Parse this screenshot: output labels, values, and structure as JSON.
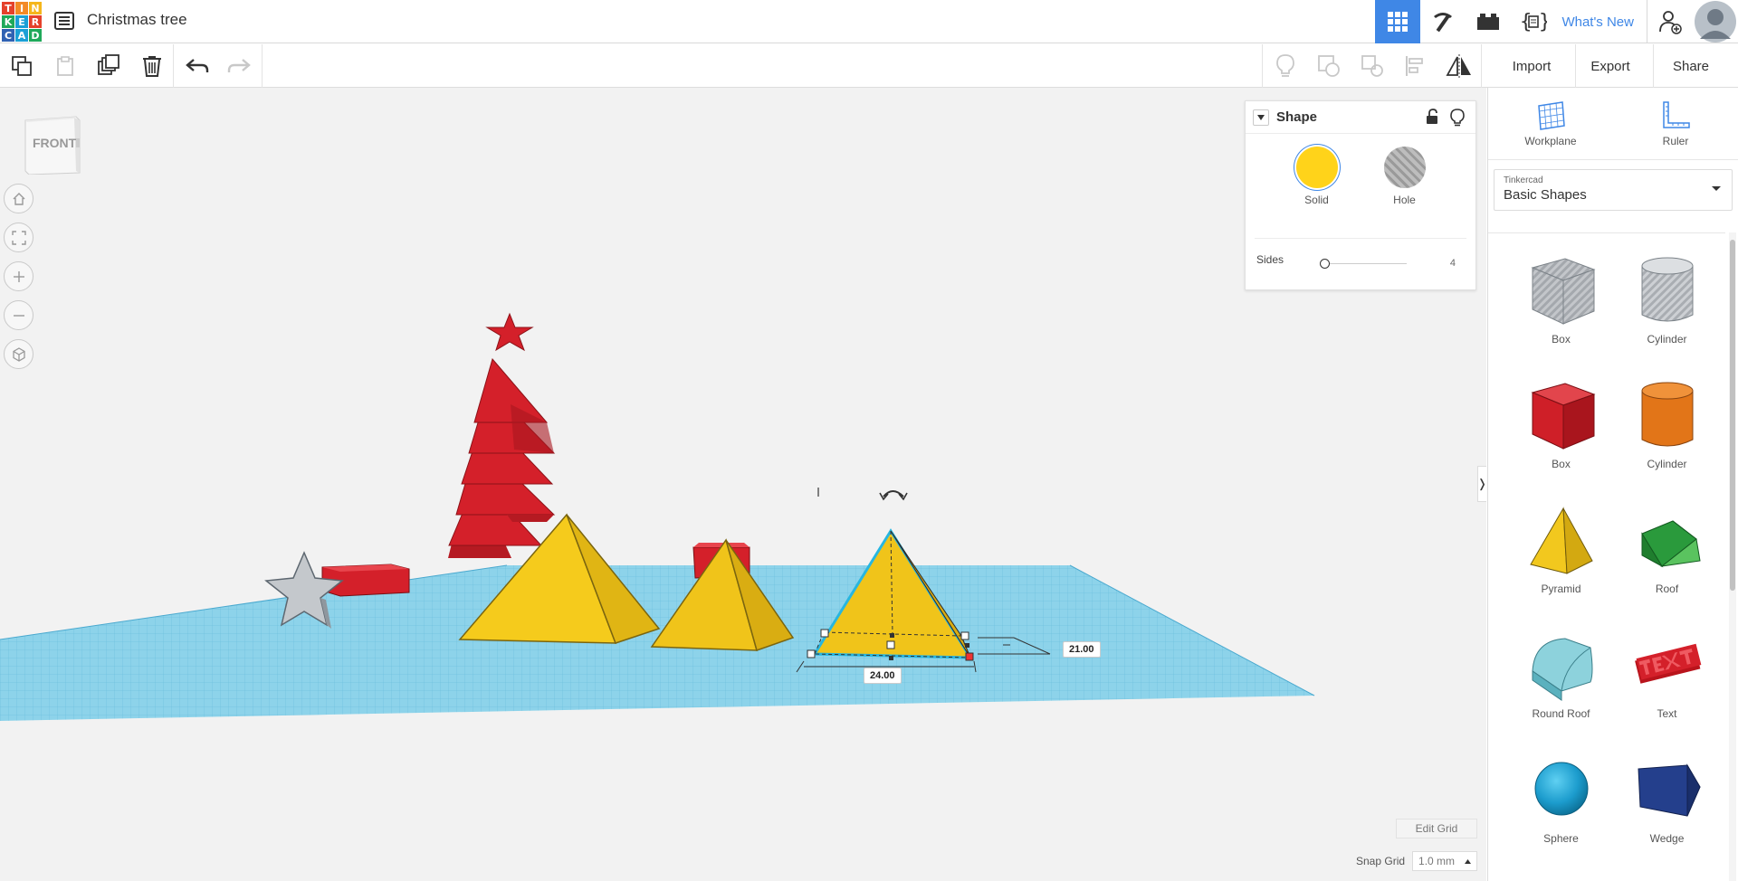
{
  "logo": {
    "letters": [
      "T",
      "I",
      "N",
      "K",
      "E",
      "R",
      "C",
      "A",
      "D"
    ]
  },
  "document": {
    "title": "Christmas tree"
  },
  "topbar": {
    "whats_new": "What's New"
  },
  "toolbar": {
    "import": "Import",
    "export": "Export",
    "share": "Share"
  },
  "viewcube": {
    "face": "FRONT"
  },
  "inspector": {
    "title": "Shape",
    "solid_label": "Solid",
    "hole_label": "Hole",
    "sides_label": "Sides",
    "sides_value": "4",
    "solid_color": "#ffd31a"
  },
  "dimensions": {
    "width": "24.00",
    "depth": "21.00"
  },
  "grid": {
    "edit_label": "Edit Grid",
    "snap_label": "Snap Grid",
    "snap_value": "1.0 mm"
  },
  "panel": {
    "workplane": "Workplane",
    "ruler": "Ruler",
    "library_group": "Tinkercad",
    "library_name": "Basic Shapes",
    "shapes": [
      {
        "label": "Box",
        "icon": "box-hole-icon"
      },
      {
        "label": "Cylinder",
        "icon": "cylinder-hole-icon"
      },
      {
        "label": "Box",
        "icon": "box-icon"
      },
      {
        "label": "Cylinder",
        "icon": "cylinder-icon"
      },
      {
        "label": "Pyramid",
        "icon": "pyramid-icon"
      },
      {
        "label": "Roof",
        "icon": "roof-icon"
      },
      {
        "label": "Round Roof",
        "icon": "round-roof-icon"
      },
      {
        "label": "Text",
        "icon": "text-icon"
      },
      {
        "label": "Sphere",
        "icon": "sphere-icon"
      },
      {
        "label": "Wedge",
        "icon": "wedge-icon"
      }
    ]
  },
  "colors": {
    "accent": "#3f87e6",
    "grid": "#7fcbe6",
    "shape_yellow": "#f2c81e",
    "shape_red": "#d4202a"
  }
}
